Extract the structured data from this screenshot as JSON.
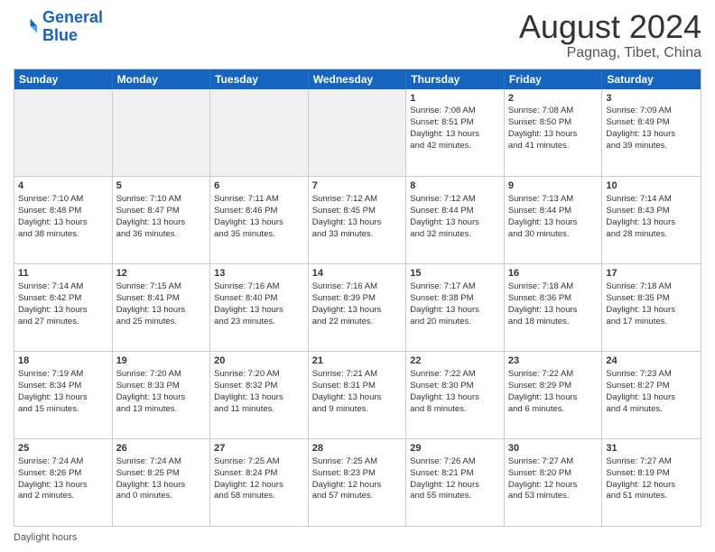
{
  "header": {
    "logo_line1": "General",
    "logo_line2": "Blue",
    "month_year": "August 2024",
    "location": "Pagnag, Tibet, China"
  },
  "days_of_week": [
    "Sunday",
    "Monday",
    "Tuesday",
    "Wednesday",
    "Thursday",
    "Friday",
    "Saturday"
  ],
  "footer_text": "Daylight hours",
  "weeks": [
    [
      {
        "day": "",
        "info": "",
        "shaded": true
      },
      {
        "day": "",
        "info": "",
        "shaded": true
      },
      {
        "day": "",
        "info": "",
        "shaded": true
      },
      {
        "day": "",
        "info": "",
        "shaded": true
      },
      {
        "day": "1",
        "info": "Sunrise: 7:08 AM\nSunset: 8:51 PM\nDaylight: 13 hours\nand 42 minutes."
      },
      {
        "day": "2",
        "info": "Sunrise: 7:08 AM\nSunset: 8:50 PM\nDaylight: 13 hours\nand 41 minutes."
      },
      {
        "day": "3",
        "info": "Sunrise: 7:09 AM\nSunset: 8:49 PM\nDaylight: 13 hours\nand 39 minutes."
      }
    ],
    [
      {
        "day": "4",
        "info": "Sunrise: 7:10 AM\nSunset: 8:48 PM\nDaylight: 13 hours\nand 38 minutes."
      },
      {
        "day": "5",
        "info": "Sunrise: 7:10 AM\nSunset: 8:47 PM\nDaylight: 13 hours\nand 36 minutes."
      },
      {
        "day": "6",
        "info": "Sunrise: 7:11 AM\nSunset: 8:46 PM\nDaylight: 13 hours\nand 35 minutes."
      },
      {
        "day": "7",
        "info": "Sunrise: 7:12 AM\nSunset: 8:45 PM\nDaylight: 13 hours\nand 33 minutes."
      },
      {
        "day": "8",
        "info": "Sunrise: 7:12 AM\nSunset: 8:44 PM\nDaylight: 13 hours\nand 32 minutes."
      },
      {
        "day": "9",
        "info": "Sunrise: 7:13 AM\nSunset: 8:44 PM\nDaylight: 13 hours\nand 30 minutes."
      },
      {
        "day": "10",
        "info": "Sunrise: 7:14 AM\nSunset: 8:43 PM\nDaylight: 13 hours\nand 28 minutes."
      }
    ],
    [
      {
        "day": "11",
        "info": "Sunrise: 7:14 AM\nSunset: 8:42 PM\nDaylight: 13 hours\nand 27 minutes."
      },
      {
        "day": "12",
        "info": "Sunrise: 7:15 AM\nSunset: 8:41 PM\nDaylight: 13 hours\nand 25 minutes."
      },
      {
        "day": "13",
        "info": "Sunrise: 7:16 AM\nSunset: 8:40 PM\nDaylight: 13 hours\nand 23 minutes."
      },
      {
        "day": "14",
        "info": "Sunrise: 7:16 AM\nSunset: 8:39 PM\nDaylight: 13 hours\nand 22 minutes."
      },
      {
        "day": "15",
        "info": "Sunrise: 7:17 AM\nSunset: 8:38 PM\nDaylight: 13 hours\nand 20 minutes."
      },
      {
        "day": "16",
        "info": "Sunrise: 7:18 AM\nSunset: 8:36 PM\nDaylight: 13 hours\nand 18 minutes."
      },
      {
        "day": "17",
        "info": "Sunrise: 7:18 AM\nSunset: 8:35 PM\nDaylight: 13 hours\nand 17 minutes."
      }
    ],
    [
      {
        "day": "18",
        "info": "Sunrise: 7:19 AM\nSunset: 8:34 PM\nDaylight: 13 hours\nand 15 minutes."
      },
      {
        "day": "19",
        "info": "Sunrise: 7:20 AM\nSunset: 8:33 PM\nDaylight: 13 hours\nand 13 minutes."
      },
      {
        "day": "20",
        "info": "Sunrise: 7:20 AM\nSunset: 8:32 PM\nDaylight: 13 hours\nand 11 minutes."
      },
      {
        "day": "21",
        "info": "Sunrise: 7:21 AM\nSunset: 8:31 PM\nDaylight: 13 hours\nand 9 minutes."
      },
      {
        "day": "22",
        "info": "Sunrise: 7:22 AM\nSunset: 8:30 PM\nDaylight: 13 hours\nand 8 minutes."
      },
      {
        "day": "23",
        "info": "Sunrise: 7:22 AM\nSunset: 8:29 PM\nDaylight: 13 hours\nand 6 minutes."
      },
      {
        "day": "24",
        "info": "Sunrise: 7:23 AM\nSunset: 8:27 PM\nDaylight: 13 hours\nand 4 minutes."
      }
    ],
    [
      {
        "day": "25",
        "info": "Sunrise: 7:24 AM\nSunset: 8:26 PM\nDaylight: 13 hours\nand 2 minutes."
      },
      {
        "day": "26",
        "info": "Sunrise: 7:24 AM\nSunset: 8:25 PM\nDaylight: 13 hours\nand 0 minutes."
      },
      {
        "day": "27",
        "info": "Sunrise: 7:25 AM\nSunset: 8:24 PM\nDaylight: 12 hours\nand 58 minutes."
      },
      {
        "day": "28",
        "info": "Sunrise: 7:25 AM\nSunset: 8:23 PM\nDaylight: 12 hours\nand 57 minutes."
      },
      {
        "day": "29",
        "info": "Sunrise: 7:26 AM\nSunset: 8:21 PM\nDaylight: 12 hours\nand 55 minutes."
      },
      {
        "day": "30",
        "info": "Sunrise: 7:27 AM\nSunset: 8:20 PM\nDaylight: 12 hours\nand 53 minutes."
      },
      {
        "day": "31",
        "info": "Sunrise: 7:27 AM\nSunset: 8:19 PM\nDaylight: 12 hours\nand 51 minutes."
      }
    ]
  ]
}
